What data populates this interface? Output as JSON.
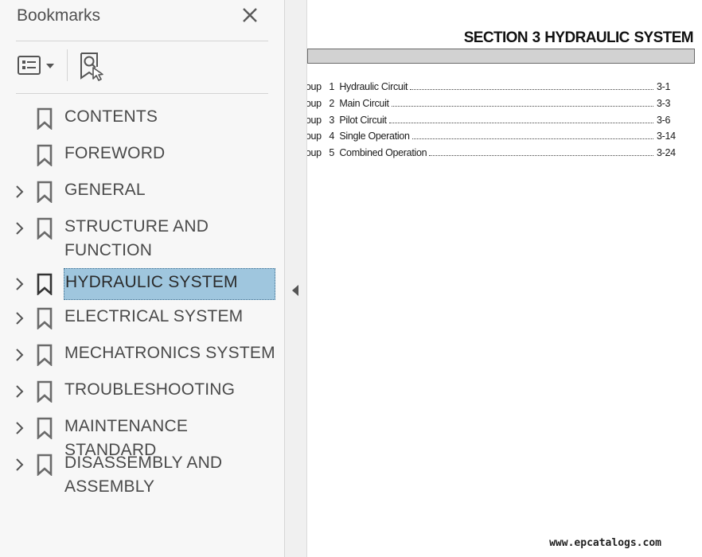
{
  "bookmarks_panel": {
    "title": "Bookmarks",
    "close_icon": "close-icon",
    "options_icon": "bookmark-options-icon",
    "find_icon": "find-current-bookmark-icon",
    "items": [
      {
        "label": "CONTENTS",
        "expandable": false,
        "selected": false
      },
      {
        "label": "FOREWORD",
        "expandable": false,
        "selected": false
      },
      {
        "label": "GENERAL",
        "expandable": true,
        "selected": false
      },
      {
        "label": "STRUCTURE AND\nFUNCTION",
        "expandable": true,
        "selected": false
      },
      {
        "label": "HYDRAULIC SYSTEM",
        "expandable": true,
        "selected": true
      },
      {
        "label": "ELECTRICAL SYSTEM",
        "expandable": true,
        "selected": false
      },
      {
        "label": "MECHATRONICS SYSTEM",
        "expandable": true,
        "selected": false
      },
      {
        "label": "TROUBLESHOOTING",
        "expandable": true,
        "selected": false
      },
      {
        "label": "MAINTENANCE STANDARD",
        "expandable": true,
        "selected": false
      },
      {
        "label": "DISASSEMBLY AND\nASSEMBLY",
        "expandable": true,
        "selected": false
      }
    ],
    "selected_color": "#9fc6de"
  },
  "splitter": {
    "collapse_icon": "collapse-left-icon"
  },
  "document": {
    "section_title": "SECTION  3  HYDRAULIC SYSTEM",
    "toc": [
      {
        "left": "roup   1  Hydraulic Circuit",
        "page": "3-1"
      },
      {
        "left": "roup   2  Main Circuit",
        "page": "3-3"
      },
      {
        "left": "roup   3  Pilot Circuit",
        "page": "3-6"
      },
      {
        "left": "roup   4  Single Operation",
        "page": "3-14"
      },
      {
        "left": "roup   5  Combined Operation",
        "page": "3-24"
      }
    ],
    "footer_url": "www.epcatalogs.com"
  }
}
